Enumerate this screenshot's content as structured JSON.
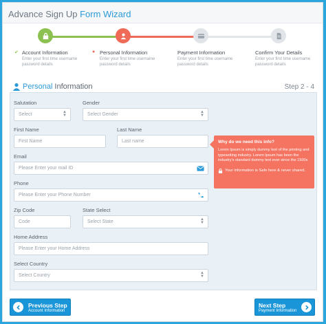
{
  "header": {
    "title_plain": "Advance Sign Up ",
    "title_accent": "Form Wizard"
  },
  "steps": [
    {
      "label": "Account Information",
      "desc": "Enter your first time username password details",
      "state": "complete",
      "color": "#8cc152",
      "icon": "lock-icon"
    },
    {
      "label": "Personal Information",
      "desc": "Enter your first time username password details",
      "state": "active",
      "color": "#ef6b57",
      "icon": "user-icon"
    },
    {
      "label": "Payment Information",
      "desc": "Enter your first time username password details",
      "state": "pending",
      "color": "#e1e4e8",
      "icon": "credit-card-icon"
    },
    {
      "label": "Confirm Your Details",
      "desc": "Enter your first time username password details",
      "state": "pending",
      "color": "#e1e4e8",
      "icon": "document-icon"
    }
  ],
  "section": {
    "title_accent": "Personal",
    "title_rest": "Information",
    "step_count": "Step 2 - 4"
  },
  "form": {
    "salutation": {
      "label": "Salutation",
      "value": "Select"
    },
    "gender": {
      "label": "Gender",
      "value": "Select Gender"
    },
    "first_name": {
      "label": "First Name",
      "placeholder": "First Name"
    },
    "last_name": {
      "label": "Last Name",
      "placeholder": "Last name"
    },
    "email": {
      "label": "Email",
      "placeholder": "Please Enter your mail ID"
    },
    "phone": {
      "label": "Phone",
      "placeholder": "Please Enter your Phone Number"
    },
    "zip": {
      "label": "Zip Code",
      "placeholder": "Code"
    },
    "state": {
      "label": "State Select",
      "value": "Select State"
    },
    "address": {
      "label": "Home Address",
      "placeholder": "Please Enter your Home Address"
    },
    "country": {
      "label": "Select Country",
      "value": "Select Country"
    }
  },
  "tooltip": {
    "title": "Why do we need this info?",
    "body": "Lorem Ipsum is simply dummy text of the printing and typesetting industry. Lorem Ipsum has been the industry's standard dummy text ever since the 1500s",
    "footer": "Your information is Safe here & never shared."
  },
  "nav": {
    "prev_main": "Previous Step",
    "prev_sub": "Account Information",
    "next_main": "Next Step",
    "next_sub": "Payment Information"
  },
  "colors": {
    "accent": "#2a9ad8",
    "complete": "#8cc152",
    "active": "#ef6b57",
    "tooltip": "#f47361",
    "button": "#1a96d8"
  }
}
